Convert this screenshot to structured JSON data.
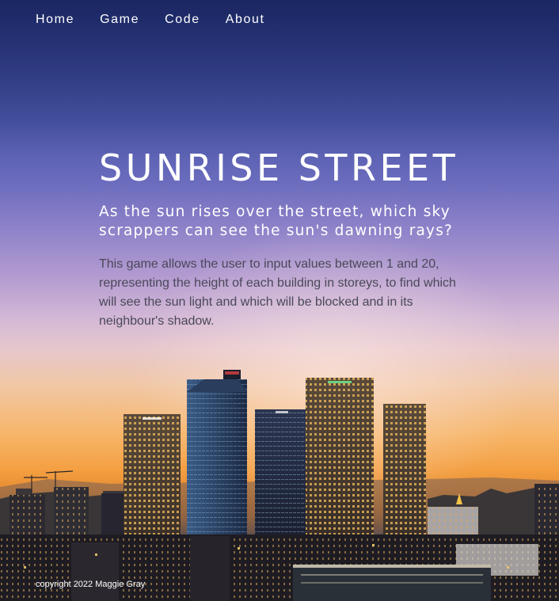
{
  "nav": {
    "items": [
      {
        "label": "Home"
      },
      {
        "label": "Game"
      },
      {
        "label": "Code"
      },
      {
        "label": "About"
      }
    ]
  },
  "hero": {
    "title": "SUNRISE STREET",
    "subtitle": "As the sun rises over the street, which sky scrappers can see the sun's dawning rays?",
    "description": "This game allows the user to input values between 1 and 20, representing the height of each building in storeys, to find which will see the sun light and which will be blocked and in its neighbour's shadow."
  },
  "footer": {
    "copyright": "copyright 2022 Maggie Gray"
  },
  "colors": {
    "text": "#ffffff",
    "description_text": "#4a4858",
    "sky_top": "#26357a",
    "horizon": "#f4a043"
  }
}
